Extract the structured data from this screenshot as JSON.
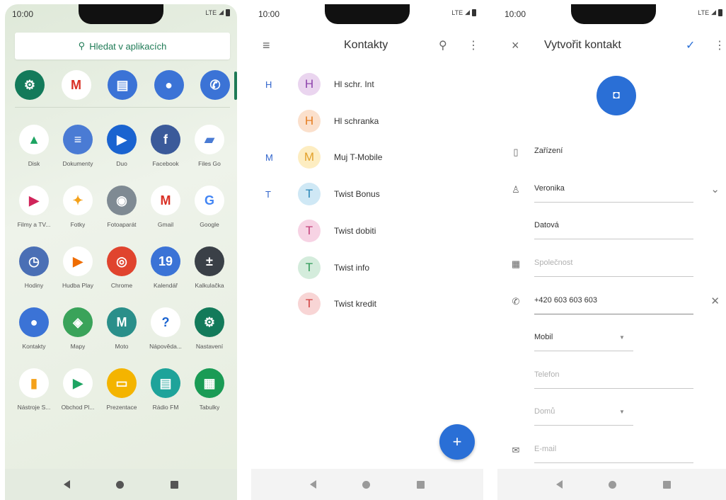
{
  "status": {
    "time": "10:00",
    "signal": "LTE"
  },
  "drawer": {
    "search_placeholder": "Hledat v aplikacích",
    "dock": [
      {
        "name": "settings",
        "color": "#137a5a",
        "glyph": "⚙"
      },
      {
        "name": "gmail",
        "color": "#ffffff",
        "glyph": "M",
        "fg": "#d93025"
      },
      {
        "name": "messages",
        "color": "#3b73d6",
        "glyph": "▤"
      },
      {
        "name": "contacts",
        "color": "#3b73d6",
        "glyph": "●"
      },
      {
        "name": "phone",
        "color": "#3b73d6",
        "glyph": "✆"
      }
    ],
    "apps": [
      {
        "label": "Disk",
        "color": "#ffffff",
        "glyph": "▲",
        "fg": "#1da462"
      },
      {
        "label": "Dokumenty",
        "color": "#4a7bd4",
        "glyph": "≡"
      },
      {
        "label": "Duo",
        "color": "#1a63d0",
        "glyph": "▶"
      },
      {
        "label": "Facebook",
        "color": "#3b5a9a",
        "glyph": "f"
      },
      {
        "label": "Files Go",
        "color": "#ffffff",
        "glyph": "▰",
        "fg": "#4a7bd4"
      },
      {
        "label": "Filmy a TV...",
        "color": "#ffffff",
        "glyph": "▶",
        "fg": "#d0245a"
      },
      {
        "label": "Fotky",
        "color": "#ffffff",
        "glyph": "✦",
        "fg": "#f4a11a"
      },
      {
        "label": "Fotoaparát",
        "color": "#7f8a93",
        "glyph": "◉"
      },
      {
        "label": "Gmail",
        "color": "#ffffff",
        "glyph": "M",
        "fg": "#d93025"
      },
      {
        "label": "Google",
        "color": "#ffffff",
        "glyph": "G",
        "fg": "#4285f4"
      },
      {
        "label": "Hodiny",
        "color": "#4a6fb5",
        "glyph": "◷"
      },
      {
        "label": "Hudba Play",
        "color": "#ffffff",
        "glyph": "▶",
        "fg": "#ef6c00"
      },
      {
        "label": "Chrome",
        "color": "#e0442e",
        "glyph": "◎"
      },
      {
        "label": "Kalendář",
        "color": "#3b73d6",
        "glyph": "19"
      },
      {
        "label": "Kalkulačka",
        "color": "#3a4047",
        "glyph": "±"
      },
      {
        "label": "Kontakty",
        "color": "#3b73d6",
        "glyph": "●"
      },
      {
        "label": "Mapy",
        "color": "#3aa35a",
        "glyph": "◈"
      },
      {
        "label": "Moto",
        "color": "#2a8f8a",
        "glyph": "M"
      },
      {
        "label": "Nápověda...",
        "color": "#ffffff",
        "glyph": "?",
        "fg": "#1a63d0"
      },
      {
        "label": "Nastavení",
        "color": "#137a5a",
        "glyph": "⚙"
      },
      {
        "label": "Nástroje S...",
        "color": "#ffffff",
        "glyph": "▮",
        "fg": "#f4a11a"
      },
      {
        "label": "Obchod Pl...",
        "color": "#ffffff",
        "glyph": "▶",
        "fg": "#1da462"
      },
      {
        "label": "Prezentace",
        "color": "#f4b400",
        "glyph": "▭"
      },
      {
        "label": "Rádio FM",
        "color": "#1ea39a",
        "glyph": "▤"
      },
      {
        "label": "Tabulky",
        "color": "#1a9b55",
        "glyph": "▦"
      }
    ]
  },
  "contacts": {
    "title": "Kontakty",
    "items": [
      {
        "index": "H",
        "initial": "H",
        "name": "Hl schr. Int",
        "bg": "#ead5ef",
        "fg": "#8e44ad"
      },
      {
        "index": "",
        "initial": "H",
        "name": "Hl schranka",
        "bg": "#fbe0cc",
        "fg": "#e67e22"
      },
      {
        "index": "M",
        "initial": "M",
        "name": "Muj T-Mobile",
        "bg": "#fdedc1",
        "fg": "#e2a12b"
      },
      {
        "index": "T",
        "initial": "T",
        "name": "Twist Bonus",
        "bg": "#cfe8f5",
        "fg": "#2a86b8"
      },
      {
        "index": "",
        "initial": "T",
        "name": "Twist dobiti",
        "bg": "#f7d3e4",
        "fg": "#c2407a"
      },
      {
        "index": "",
        "initial": "T",
        "name": "Twist info",
        "bg": "#d4ecdc",
        "fg": "#2e9a57"
      },
      {
        "index": "",
        "initial": "T",
        "name": "Twist kredit",
        "bg": "#f8d5d5",
        "fg": "#d04040"
      }
    ],
    "fab": "+"
  },
  "create": {
    "title": "Vytvořit kontakt",
    "account": "Zařízení",
    "first_name": "Veronika",
    "last_name": "Datová",
    "company_placeholder": "Společnost",
    "phone": "+420 603 603 603",
    "phone_type": "Mobil",
    "phone2_placeholder": "Telefon",
    "phone2_type": "Domů",
    "email_placeholder": "E-mail"
  }
}
